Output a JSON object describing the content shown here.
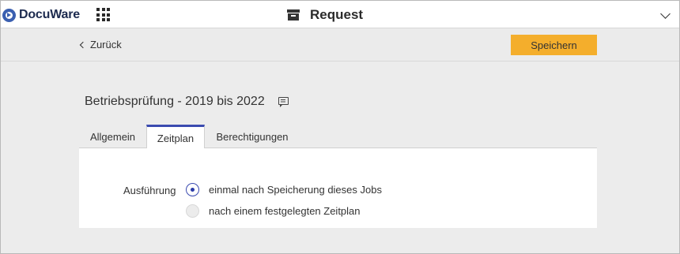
{
  "header": {
    "brand": "DocuWare",
    "app_title": "Request",
    "icons": {
      "logo": "docuware-logo-icon",
      "apps": "apps-grid-icon",
      "title": "archive-box-icon",
      "menu": "chevron-down-icon"
    }
  },
  "actionbar": {
    "back_label": "Zurück",
    "save_label": "Speichern",
    "save_color": "#f4ae2c"
  },
  "document": {
    "title": "Betriebsprüfung - 2019 bis 2022",
    "comment_icon": "comment-icon"
  },
  "tabs": [
    {
      "label": "Allgemein",
      "active": false
    },
    {
      "label": "Zeitplan",
      "active": true
    },
    {
      "label": "Berechtigungen",
      "active": false
    }
  ],
  "schedule": {
    "label": "Ausführung",
    "options": [
      {
        "label": "einmal nach Speicherung dieses Jobs",
        "selected": true
      },
      {
        "label": "nach einem festgelegten Zeitplan",
        "selected": false
      }
    ]
  },
  "colors": {
    "accent": "#3b4bb0",
    "primary_button": "#f4ae2c",
    "background": "#ececec"
  }
}
